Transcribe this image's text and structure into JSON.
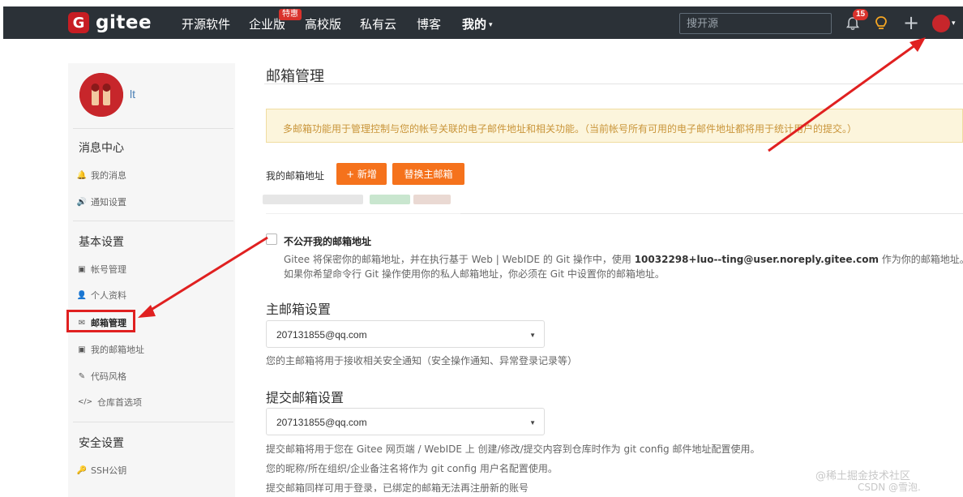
{
  "nav": {
    "logo_letter": "G",
    "logo_text": "gitee",
    "items": [
      "开源软件",
      "企业版",
      "高校版",
      "私有云",
      "博客",
      "我的"
    ],
    "badge": "特惠",
    "search_placeholder": "搜开源",
    "notification_count": "15",
    "plus": "+",
    "caret": "▾"
  },
  "sidebar": {
    "user_name": "lt",
    "sections": [
      {
        "heading": "消息中心",
        "items": [
          "我的消息",
          "通知设置"
        ]
      },
      {
        "heading": "基本设置",
        "items": [
          "帐号管理",
          "个人资料",
          "邮箱管理",
          "我的邮箱地址",
          "代码风格",
          "仓库首选项"
        ]
      },
      {
        "heading": "安全设置",
        "items": [
          "SSH公钥"
        ]
      }
    ],
    "icons": {
      "msg": "🔔",
      "notify": "🔊",
      "account": "▣",
      "profile": "👤",
      "mail": "✉",
      "addr": "▣",
      "style": "✎",
      "repo": "</>",
      "ssh": "🔑"
    }
  },
  "main": {
    "title": "邮箱管理",
    "notice": "多邮箱功能用于管理控制与您的帐号关联的电子邮件地址和相关功能。（当前帐号所有可用的电子邮件地址都将用于统计用户的提交。）",
    "address_label": "我的邮箱地址",
    "add_button": "+ 新增",
    "switch_button": "替换主邮箱",
    "private_checkbox_label": "不公开我的邮箱地址",
    "private_hint_1_prefix": "Gitee 将保密你的邮箱地址，并在执行基于 Web | WebIDE 的 Git 操作中，使用 ",
    "private_hint_1_email": "10032298+luo--ting@user.noreply.gitee.com",
    "private_hint_1_suffix": " 作为你的邮箱地址。",
    "private_hint_2": "如果你希望命令行 Git 操作使用你的私人邮箱地址，你必须在 Git 中设置你的邮箱地址。",
    "primary_title": "主邮箱设置",
    "primary_value": "207131855@qq.com",
    "primary_help": "您的主邮箱将用于接收相关安全通知（安全操作通知、异常登录记录等）",
    "commit_title": "提交邮箱设置",
    "commit_value": "207131855@qq.com",
    "commit_help_1": "提交邮箱将用于您在 Gitee 网页端 / WebIDE 上 创建/修改/提交内容到仓库时作为 git config 邮件地址配置使用。",
    "commit_help_2": "您的昵称/所在组织/企业备注名将作为 git config 用户名配置使用。",
    "commit_help_3": "提交邮箱同样可用于登录，已绑定的邮箱无法再注册新的账号",
    "dropdown_caret": "▼"
  },
  "watermark": {
    "line1": "@稀土掘金技术社区",
    "line2": "CSDN @雪泡."
  },
  "colors": {
    "nav_bg": "#2b3137",
    "brand_red": "#c71d23",
    "orange": "#f5721c",
    "annotation_red": "#e02020"
  }
}
